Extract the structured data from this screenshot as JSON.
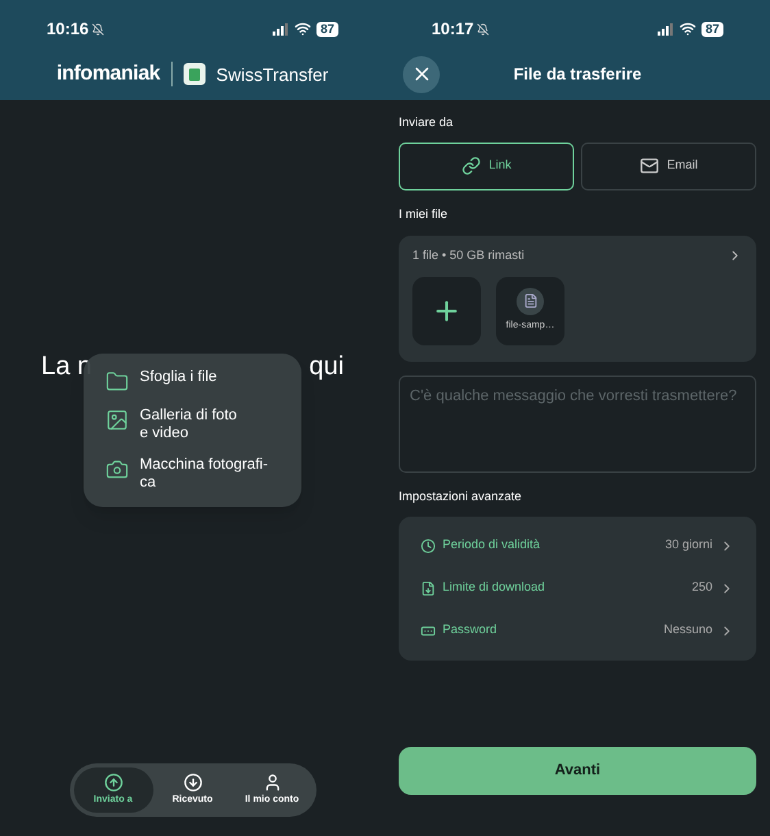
{
  "left_screen": {
    "status_bar": {
      "time": "10:16",
      "battery": "87"
    },
    "header": {
      "brand": "infomaniak",
      "app": "SwissTransfer"
    },
    "headline_parts": [
      "La n",
      "qui"
    ],
    "menu": {
      "items": [
        {
          "kind": "folder",
          "label": "Sfoglia i file"
        },
        {
          "kind": "gallery",
          "label": "Galleria di foto\ne video"
        },
        {
          "kind": "camera",
          "label": "Macchina fotografi-\nca"
        }
      ]
    },
    "tabs": [
      {
        "kind": "sent",
        "label": "Inviato a",
        "selected": true
      },
      {
        "kind": "received",
        "label": "Ricevuto",
        "selected": false
      },
      {
        "kind": "account",
        "label": "Il mio conto",
        "selected": false
      }
    ]
  },
  "right_screen": {
    "status_bar": {
      "time": "10:17",
      "battery": "87"
    },
    "header": {
      "title": "File da trasferire"
    },
    "send_from": {
      "label": "Inviare da",
      "options": [
        {
          "kind": "link",
          "label": "Link",
          "selected": true
        },
        {
          "kind": "email",
          "label": "Email",
          "selected": false
        }
      ]
    },
    "files": {
      "label": "I miei file",
      "summary": "1 file • 50 GB rimasti",
      "items": [
        {
          "name": "file-samp…"
        }
      ]
    },
    "message": {
      "placeholder": "C'è qualche messaggio che vorresti trasmettere?"
    },
    "advanced": {
      "label": "Impostazioni avanzate",
      "rows": [
        {
          "kind": "validity",
          "label": "Periodo di validità",
          "value": "30 giorni"
        },
        {
          "kind": "download_limit",
          "label": "Limite di download",
          "value": "250"
        },
        {
          "kind": "password",
          "label": "Password",
          "value": "Nessuno"
        }
      ]
    },
    "button": "Avanti"
  }
}
